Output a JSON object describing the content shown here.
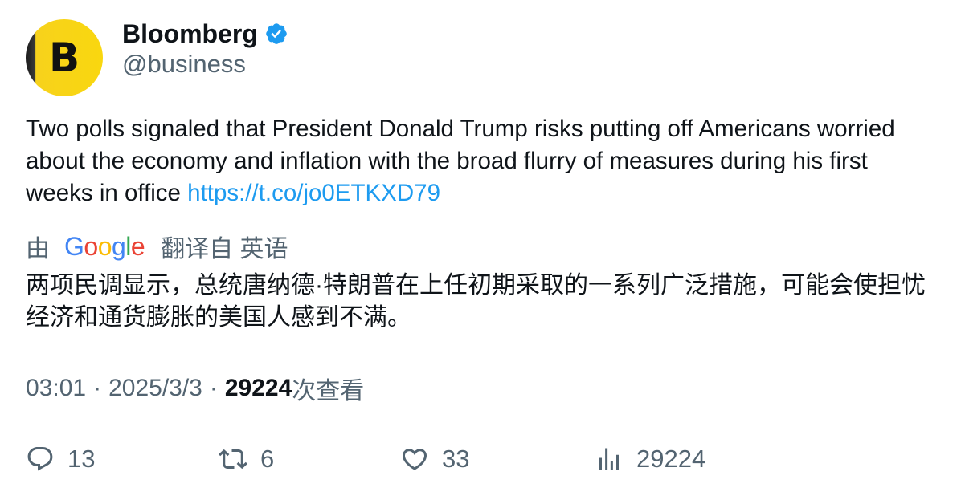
{
  "author": {
    "name": "Bloomberg",
    "handle": "@business",
    "avatar_letter": "B",
    "verified": true,
    "verified_color": "#1d9bf0"
  },
  "tweet": {
    "text": "Two polls signaled that President Donald Trump risks putting off Americans worried about the economy and inflation with the broad flurry of measures during his first weeks in office ",
    "link": "https://t.co/jo0ETKXD79",
    "link_color": "#1d9bf0"
  },
  "translation": {
    "prefix": "由",
    "provider_letters": [
      "G",
      "o",
      "o",
      "g",
      "l",
      "e"
    ],
    "suffix": "翻译自 英语",
    "text": "两项民调显示，总统唐纳德·特朗普在上任初期采取的一系列广泛措施，可能会使担忧经济和通货膨胀的美国人感到不满。"
  },
  "meta": {
    "time": "03:01",
    "separator": "·",
    "date": "2025/3/3",
    "views": "29224",
    "views_suffix": "次查看"
  },
  "actions": {
    "reply": {
      "icon": "reply-icon",
      "count": "13"
    },
    "retweet": {
      "icon": "retweet-icon",
      "count": "6"
    },
    "like": {
      "icon": "heart-icon",
      "count": "33"
    },
    "views": {
      "icon": "analytics-icon",
      "count": "29224"
    }
  }
}
